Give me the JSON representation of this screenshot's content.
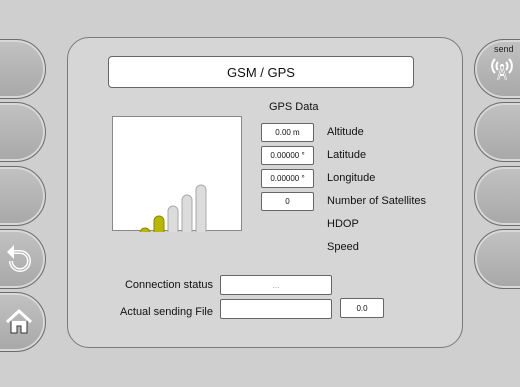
{
  "title": "GSM / GPS",
  "gps_section": {
    "label": "GPS Data"
  },
  "signal": {
    "total_bars": 5,
    "active_bars": 2,
    "active_color": "#b9b800",
    "inactive_color": "#dcdcdc"
  },
  "gps_fields": [
    {
      "value": "0.00 m",
      "label": "Altitude"
    },
    {
      "value": "0.00000 °",
      "label": "Latitude"
    },
    {
      "value": "0.00000 °",
      "label": "Longitude"
    },
    {
      "value": "0",
      "label": "Number of Satellites"
    },
    {
      "value": "",
      "label": "HDOP"
    },
    {
      "value": "",
      "label": "Speed"
    }
  ],
  "connection_status": {
    "label": "Connection status",
    "value": "..."
  },
  "sending_file": {
    "label": "Actual sending File",
    "value": "",
    "progress": "0.0"
  },
  "right_buttons": {
    "send_label": "send"
  },
  "icons": {
    "back": "back-arrow-icon",
    "home": "home-icon",
    "send": "antenna-icon"
  }
}
